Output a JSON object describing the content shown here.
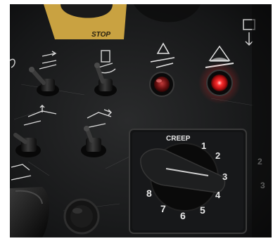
{
  "stop_label": "STOP",
  "dial": {
    "creep_label": "CREEP",
    "numbers": [
      "1",
      "2",
      "3",
      "4",
      "5",
      "6",
      "7",
      "8"
    ]
  },
  "colors": {
    "panel": "#1c1d1e",
    "stop_plate": "#d7b14a",
    "indicator_red": "#ff2a2a",
    "indicator_dark": "#6a0f10"
  },
  "icons": [
    "tilt-warning-icon",
    "drive-direction-icon",
    "platform-rotate-icon",
    "boom-lift-icon",
    "boom-extend-icon",
    "outrigger-icon",
    "arrow-down-icon"
  ]
}
